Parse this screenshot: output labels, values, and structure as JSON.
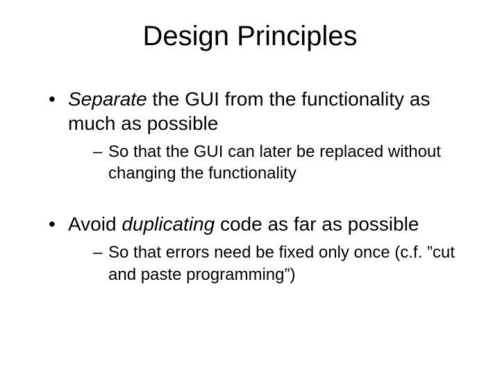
{
  "slide": {
    "title": "Design Principles",
    "bullets": [
      {
        "emphasis": "Separate",
        "rest": " the GUI from the functionality as much as possible",
        "sub": "So that the GUI can later be replaced without changing the functionality"
      },
      {
        "pre": "Avoid ",
        "emphasis": "duplicating",
        "rest": " code as far as possible",
        "sub": "So that errors need be fixed only once (c.f. ”cut and paste programming”)"
      }
    ]
  }
}
